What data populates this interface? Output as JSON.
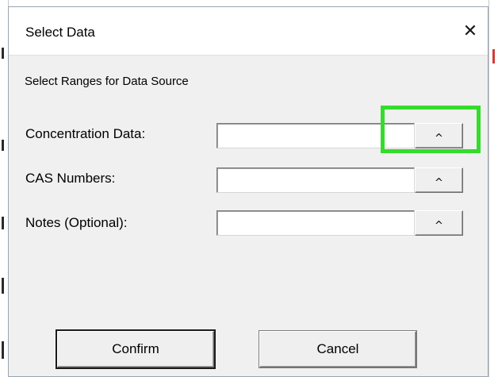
{
  "dialog": {
    "title": "Select Data",
    "close_glyph": "✕",
    "subtitle": "Select Ranges for Data Source"
  },
  "fields": [
    {
      "label": "Concentration Data:",
      "value": "",
      "picker_glyph": "^"
    },
    {
      "label": "CAS Numbers:",
      "value": "",
      "picker_glyph": "^"
    },
    {
      "label": "Notes (Optional):",
      "value": "",
      "picker_glyph": "^"
    }
  ],
  "buttons": {
    "confirm_label": "Confirm",
    "cancel_label": "Cancel"
  },
  "colors": {
    "highlight": "#33dd2a",
    "dialog_background": "#f0f0f0",
    "titlebar_background": "#ffffff"
  },
  "icons": {
    "close": "close-icon",
    "picker": "caret-up-icon"
  }
}
